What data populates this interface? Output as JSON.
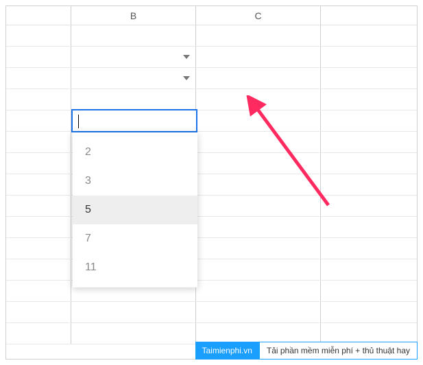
{
  "columns": {
    "b": "B",
    "c": "C"
  },
  "dropdown": {
    "items": [
      "2",
      "3",
      "5",
      "7",
      "11"
    ],
    "highlighted_index": 2
  },
  "active_cell": {
    "value": ""
  },
  "footer": {
    "brand": "Taimienphi.vn",
    "tagline": "Tải phần mềm miễn phí + thủ thuật hay"
  }
}
